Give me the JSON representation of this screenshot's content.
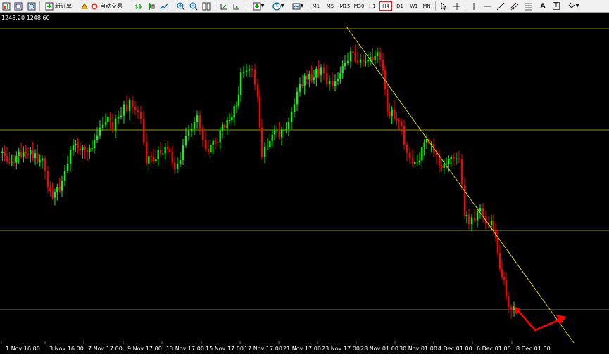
{
  "toolbar": {
    "new_order_label": "新订单",
    "auto_trading_label": "自动交易",
    "timeframes": [
      "M1",
      "M5",
      "M15",
      "M30",
      "H1",
      "H4",
      "D1",
      "W1",
      "MN"
    ],
    "active_timeframe": "H4",
    "text_tool_label": "A",
    "text_label_tool_label": "T"
  },
  "chart": {
    "price_readout": "1248.20 1248.60",
    "background": "#000000",
    "bull_color": "#00ff00",
    "bear_color": "#ff0000",
    "hline_color": "#c8c800",
    "trendline_color": "#e6e600",
    "bottom_line_color": "#a0a0a0",
    "arrow_color": "#ff0000",
    "x_ticks": [
      "1 Nov 16:00",
      "3 Nov 16:00",
      "7 Nov 17:00",
      "9 Nov 17:00",
      "13 Nov 17:00",
      "15 Nov 17:00",
      "17 Nov 17:00",
      "21 Nov 17:00",
      "23 Nov 17:00",
      "28 Nov 01:00",
      "30 Nov 01:00",
      "4 Dec 01:00",
      "6 Dec 01:00",
      "8 Dec 01:00"
    ]
  }
}
